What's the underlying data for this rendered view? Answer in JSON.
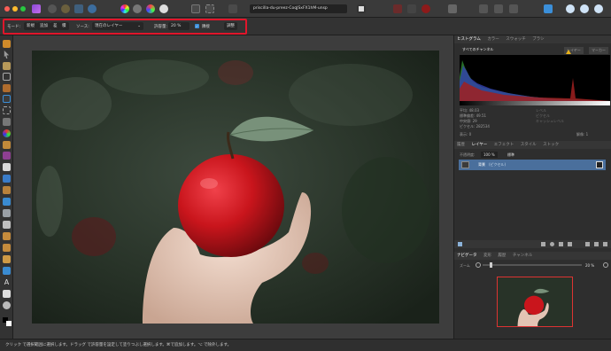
{
  "document": {
    "title": "priscilla-du-preez-CoqJSxFX1hM-unsp"
  },
  "context_bar": {
    "mode_label": "モード:",
    "mode_new": "新規",
    "mode_add": "追加",
    "mode_subtract": "差",
    "mode_intersect": "積",
    "source_label": "ソース:",
    "source_value": "現在のレイヤー",
    "tolerance_label": "許容量:",
    "tolerance_value": "20 %",
    "contiguous_label": "隣接",
    "refine_label": "調整"
  },
  "histogram_panel": {
    "tabs": [
      "ヒストグラム",
      "カラー",
      "スウォッチ",
      "ブラシ"
    ],
    "channel": "すべてのチャンネル",
    "layer_button": "レイヤー",
    "marker_button": "マーカー",
    "stats": {
      "mean_label": "平均:",
      "mean_value": "48.03",
      "stddev_label": "標準偏差:",
      "stddev_value": "49.51",
      "median_label": "中央値:",
      "median_value": "29",
      "pixels_label": "ピクセル:",
      "pixels_value": "282534",
      "level_label": "レベル",
      "percent_label": "ピクセル",
      "cache_label": "キャッシュレベル"
    },
    "display_label": "表示:",
    "display_value": "0",
    "resolution_label": "解像:",
    "resolution_value": "1"
  },
  "layers_panel": {
    "tabs": [
      "履歴",
      "レイヤー",
      "エフェクト",
      "スタイル",
      "ストック"
    ],
    "opacity_label": "不透明度:",
    "opacity_value": "100 %",
    "blend_mode": "標準",
    "layer_name": "背景",
    "layer_type": "(ピクセル)"
  },
  "navigator_panel": {
    "tabs": [
      "ナビゲータ",
      "変形",
      "履歴",
      "チャンネル"
    ],
    "zoom_label": "ズーム",
    "zoom_value": "20 %"
  },
  "status_bar": {
    "text": "クリック で選択範囲に選択します。ドラッグ で許容量を設定して塗りつぶし選択します。⌘で追加します。⌥ で除外します。"
  },
  "colors": {
    "highlight": "#e0162b",
    "accent": "#3b8fd9",
    "apple": "#c9151c"
  }
}
